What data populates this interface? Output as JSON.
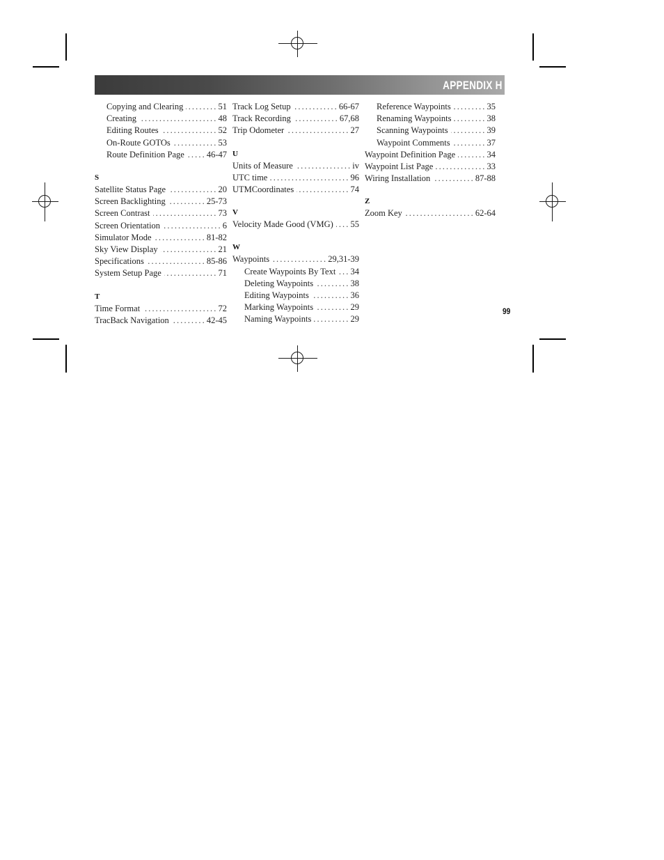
{
  "header": {
    "appendix_title": "APPENDIX H"
  },
  "page_number": "99",
  "columns": [
    {
      "id": "left",
      "blocks": [
        {
          "type": "entries",
          "entries": [
            {
              "label": "Copying  and Clearing",
              "pages": "51",
              "sub": true
            },
            {
              "label": "Creating",
              "pages": "48",
              "sub": true
            },
            {
              "label": "Editing Routes",
              "pages": "52",
              "sub": true
            },
            {
              "label": "On-Route GOTOs",
              "pages": "53",
              "sub": true
            },
            {
              "label": "Route Definition Page",
              "pages": "46-47",
              "sub": true
            }
          ]
        },
        {
          "type": "section",
          "letter": "S",
          "entries": [
            {
              "label": "Satellite Status Page",
              "pages": "20",
              "sub": false
            },
            {
              "label": "Screen Backlighting",
              "pages": "25-73",
              "sub": false
            },
            {
              "label": "Screen Contrast",
              "pages": "73",
              "sub": false
            },
            {
              "label": "Screen Orientation",
              "pages": "6",
              "sub": false
            },
            {
              "label": "Simulator Mode",
              "pages": "81-82",
              "sub": false
            },
            {
              "label": "Sky View Display",
              "pages": "21",
              "sub": false
            },
            {
              "label": "Specifications",
              "pages": "85-86",
              "sub": false
            },
            {
              "label": "System Setup Page",
              "pages": "71",
              "sub": false
            }
          ]
        },
        {
          "type": "section",
          "letter": "T",
          "entries": [
            {
              "label": "Time Format",
              "pages": "72",
              "sub": false
            },
            {
              "label": "TracBack Navigation",
              "pages": "42-45",
              "sub": false
            }
          ]
        }
      ]
    },
    {
      "id": "middle",
      "blocks": [
        {
          "type": "entries",
          "entries": [
            {
              "label": "Track Log Setup",
              "pages": "66-67",
              "sub": false
            },
            {
              "label": "Track Recording",
              "pages": "67,68",
              "sub": false
            },
            {
              "label": "Trip Odometer",
              "pages": "27",
              "sub": false
            }
          ]
        },
        {
          "type": "section",
          "letter": "U",
          "entries": [
            {
              "label": "Units of Measure",
              "pages": "iv",
              "sub": false
            },
            {
              "label": "UTC time",
              "pages": "96",
              "sub": false
            },
            {
              "label": "UTMCoordinates",
              "pages": "74",
              "sub": false
            }
          ]
        },
        {
          "type": "section",
          "letter": "V",
          "entries": [
            {
              "label": "Velocity Made Good (VMG)",
              "pages": "55",
              "sub": false
            }
          ]
        },
        {
          "type": "section",
          "letter": "W",
          "entries": [
            {
              "label": "Waypoints",
              "pages": "29,31-39",
              "sub": false
            },
            {
              "label": "Create Waypoints By Text",
              "pages": "34",
              "sub": true
            },
            {
              "label": "Deleting Waypoints",
              "pages": "38",
              "sub": true
            },
            {
              "label": "Editing Waypoints",
              "pages": "36",
              "sub": true
            },
            {
              "label": "Marking Waypoints",
              "pages": "29",
              "sub": true
            },
            {
              "label": "Naming Waypoints",
              "pages": "29",
              "sub": true
            }
          ]
        }
      ]
    },
    {
      "id": "right",
      "blocks": [
        {
          "type": "entries",
          "entries": [
            {
              "label": "Reference Waypoints",
              "pages": "35",
              "sub": true
            },
            {
              "label": "Renaming Waypoints",
              "pages": "38",
              "sub": true
            },
            {
              "label": "Scanning Waypoints",
              "pages": "39",
              "sub": true
            },
            {
              "label": "Waypoint Comments",
              "pages": "37",
              "sub": true
            },
            {
              "label": "Waypoint Definition Page",
              "pages": "34",
              "sub": false
            },
            {
              "label": "Waypoint List Page",
              "pages": "33",
              "sub": false
            },
            {
              "label": "Wiring Installation",
              "pages": "87-88",
              "sub": false
            }
          ]
        },
        {
          "type": "section",
          "letter": "Z",
          "entries": [
            {
              "label": "Zoom Key",
              "pages": "62-64",
              "sub": false
            }
          ]
        }
      ]
    }
  ]
}
